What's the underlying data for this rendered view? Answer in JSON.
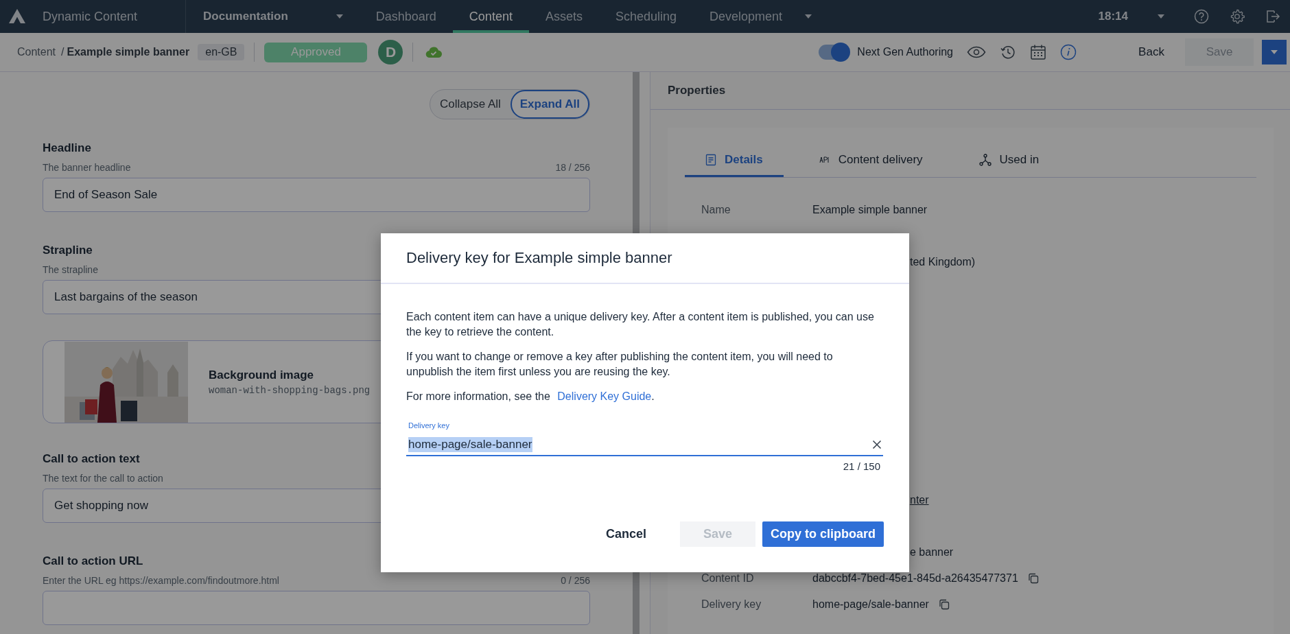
{
  "top_nav": {
    "app_name": "Dynamic Content",
    "hub": "Documentation",
    "tabs": [
      {
        "label": "Dashboard",
        "selected": false,
        "has_menu": false
      },
      {
        "label": "Content",
        "selected": true,
        "has_menu": false
      },
      {
        "label": "Assets",
        "selected": false,
        "has_menu": false
      },
      {
        "label": "Scheduling",
        "selected": false,
        "has_menu": false
      },
      {
        "label": "Development",
        "selected": false,
        "has_menu": true
      }
    ],
    "time": "18:14"
  },
  "toolbar": {
    "breadcrumb": {
      "parent": "Content",
      "separator": "/",
      "current": "Example simple banner"
    },
    "locale": "en-GB",
    "status": "Approved",
    "avatar": "D",
    "synced": true,
    "toggle": {
      "label": "Next Gen Authoring",
      "on": true
    },
    "back": "Back",
    "save": {
      "label": "Save",
      "disabled": true
    }
  },
  "editor": {
    "view_buttons": [
      {
        "label": "Collapse All",
        "selected": false
      },
      {
        "label": "Expand All",
        "selected": true
      }
    ],
    "fields": [
      {
        "kind": "text",
        "label": "Headline",
        "description": "The banner headline",
        "counter": "18 / 256",
        "value": "End of Season Sale"
      },
      {
        "kind": "text",
        "label": "Strapline",
        "description": "The strapline",
        "value": "Last bargains of the season"
      },
      {
        "label": "Background image",
        "filename": "woman-with-shopping-bags.png"
      },
      {
        "kind": "text",
        "label": "Call to action text",
        "description": "The text for the call to action",
        "value": "Get shopping now"
      },
      {
        "kind": "text",
        "label": "Call to action URL",
        "description": "Enter the URL eg https://example.com/findoutmore.html",
        "counter": "0 / 256"
      }
    ]
  },
  "properties": {
    "title": "Properties",
    "tabs": [
      {
        "label": "Details",
        "selected": true
      },
      {
        "label": "Content delivery",
        "selected": false
      },
      {
        "label": "Used in",
        "selected": false
      }
    ],
    "rows": [
      {
        "label": "Name",
        "value": "Example simple banner",
        "copyable": false,
        "link": false
      },
      {
        "value": "ted Kingdom)",
        "copyable": false,
        "link": false
      },
      {
        "value": "nter",
        "copyable": false,
        "link": true
      },
      {
        "value": "e banner",
        "copyable": false,
        "link": false
      },
      {
        "label": "Content ID",
        "value": "dabccbf4-7bed-45e1-845d-a26435477371",
        "copyable": true,
        "link": false
      },
      {
        "label": "Delivery key",
        "value": "home-page/sale-banner",
        "copyable": true,
        "link": false
      }
    ]
  },
  "dialog": {
    "title": "Delivery key for Example simple banner",
    "paragraphs": [
      {
        "text": "Each content item can have a unique delivery key. After a content item is published, you can use the key to retrieve the content."
      },
      {
        "text": "If you want to change or remove a key after publishing the content item, you will need to unpublish the item first unless you are reusing the key."
      },
      {
        "text": "For more information, see the ",
        "link": "Delivery Key Guide",
        "after": "."
      }
    ],
    "field": {
      "label": "Delivery key",
      "value": "home-page/sale-banner",
      "highlighted": true,
      "counter": "21 / 150"
    },
    "buttons": [
      {
        "kind": "text",
        "label": "Cancel",
        "disabled": false
      },
      {
        "kind": "secondary",
        "label": "Save",
        "disabled": true
      },
      {
        "kind": "primary",
        "label": "Copy to clipboard",
        "disabled": false
      }
    ]
  }
}
